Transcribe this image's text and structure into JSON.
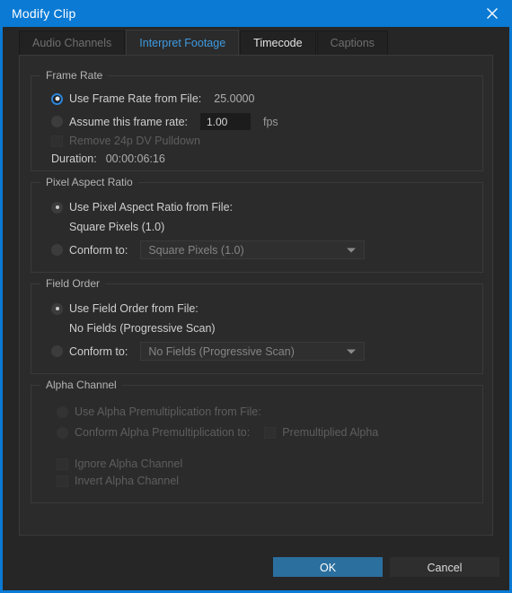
{
  "window": {
    "title": "Modify Clip",
    "close_icon": "close-icon",
    "accent_color": "#0a7ad4"
  },
  "tabs": [
    {
      "label": "Audio Channels",
      "state": "disabled"
    },
    {
      "label": "Interpret Footage",
      "state": "active"
    },
    {
      "label": "Timecode",
      "state": "enabled"
    },
    {
      "label": "Captions",
      "state": "disabled"
    }
  ],
  "frame_rate": {
    "group_title": "Frame Rate",
    "use_from_file_label": "Use Frame Rate from File:",
    "use_from_file_value": "25.0000",
    "use_from_file_selected": true,
    "assume_label": "Assume this frame rate:",
    "assume_value": "1.00",
    "assume_unit": "fps",
    "assume_selected": false,
    "remove_pulldown_label": "Remove 24p DV Pulldown",
    "remove_pulldown_checked": false,
    "remove_pulldown_disabled": true,
    "duration_label": "Duration:",
    "duration_value": "00:00:06:16"
  },
  "pixel_aspect_ratio": {
    "group_title": "Pixel Aspect Ratio",
    "use_from_file_label": "Use Pixel Aspect Ratio from File:",
    "use_from_file_value": "Square Pixels (1.0)",
    "use_from_file_selected": true,
    "conform_label": "Conform to:",
    "conform_value": "Square Pixels (1.0)",
    "conform_selected": false
  },
  "field_order": {
    "group_title": "Field Order",
    "use_from_file_label": "Use Field Order from File:",
    "use_from_file_value": "No Fields (Progressive Scan)",
    "use_from_file_selected": true,
    "conform_label": "Conform to:",
    "conform_value": "No Fields (Progressive Scan)",
    "conform_selected": false
  },
  "alpha_channel": {
    "group_title": "Alpha Channel",
    "use_premultiplication_label": "Use Alpha Premultiplication from File:",
    "conform_premultiplication_label": "Conform Alpha Premultiplication to:",
    "premultiplied_alpha_label": "Premultiplied Alpha",
    "ignore_alpha_label": "Ignore Alpha Channel",
    "invert_alpha_label": "Invert Alpha Channel",
    "disabled": true
  },
  "footer": {
    "ok_label": "OK",
    "cancel_label": "Cancel",
    "ok_color": "#2a6f9e"
  }
}
